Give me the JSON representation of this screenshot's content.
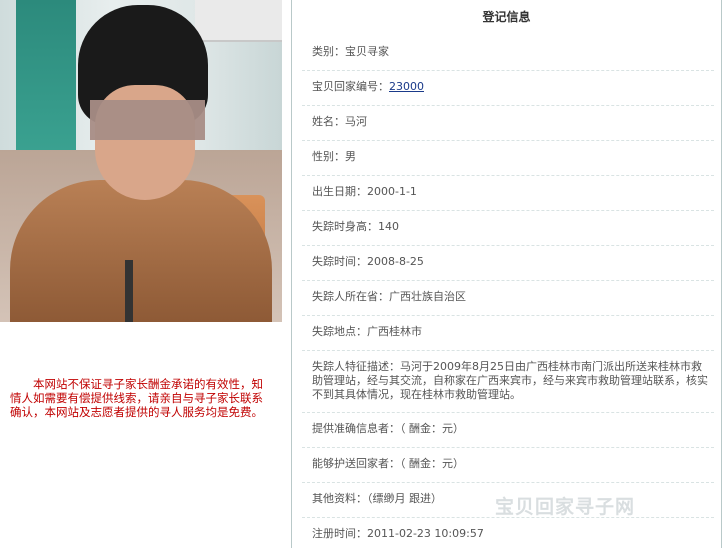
{
  "notice": {
    "text": "本网站不保证寻子家长酬金承诺的有效性，知情人如需要有偿提供线索，请亲自与寻子家长联系确认，本网站及志愿者提供的寻人服务均是免费。"
  },
  "panel": {
    "title": "登记信息",
    "rows": {
      "category": {
        "label": "类别：",
        "value": "宝贝寻家"
      },
      "id": {
        "label": "宝贝回家编号：",
        "value": "23000"
      },
      "name": {
        "label": "姓名：",
        "value": "马河"
      },
      "gender": {
        "label": "性别：",
        "value": "男"
      },
      "dob": {
        "label": "出生日期：",
        "value": "2000-1-1"
      },
      "height": {
        "label": "失踪时身高：",
        "value": "140"
      },
      "missing_date": {
        "label": "失踪时间：",
        "value": "2008-8-25"
      },
      "province": {
        "label": "失踪人所在省：",
        "value": "广西壮族自治区"
      },
      "place": {
        "label": "失踪地点：",
        "value": "广西桂林市"
      },
      "description": {
        "label": "失踪人特征描述：",
        "value": "马河于2009年8月25日由广西桂林市南门派出所送来桂林市救助管理站，经与其交流，自称家在广西来宾市，经与来宾市救助管理站联系，核实不到其具体情况，现在桂林市救助管理站。"
      },
      "informant": {
        "label": "提供准确信息者：",
        "value": "（ 酬金：元）"
      },
      "escort": {
        "label": "能够护送回家者：",
        "value": "（ 酬金：元）"
      },
      "other": {
        "label": "其他资料：",
        "value": "（缥缈月 跟进）"
      },
      "registered": {
        "label": "注册时间：",
        "value": "2011-02-23 10:09:57"
      }
    }
  },
  "watermark": "宝贝回家寻子网"
}
